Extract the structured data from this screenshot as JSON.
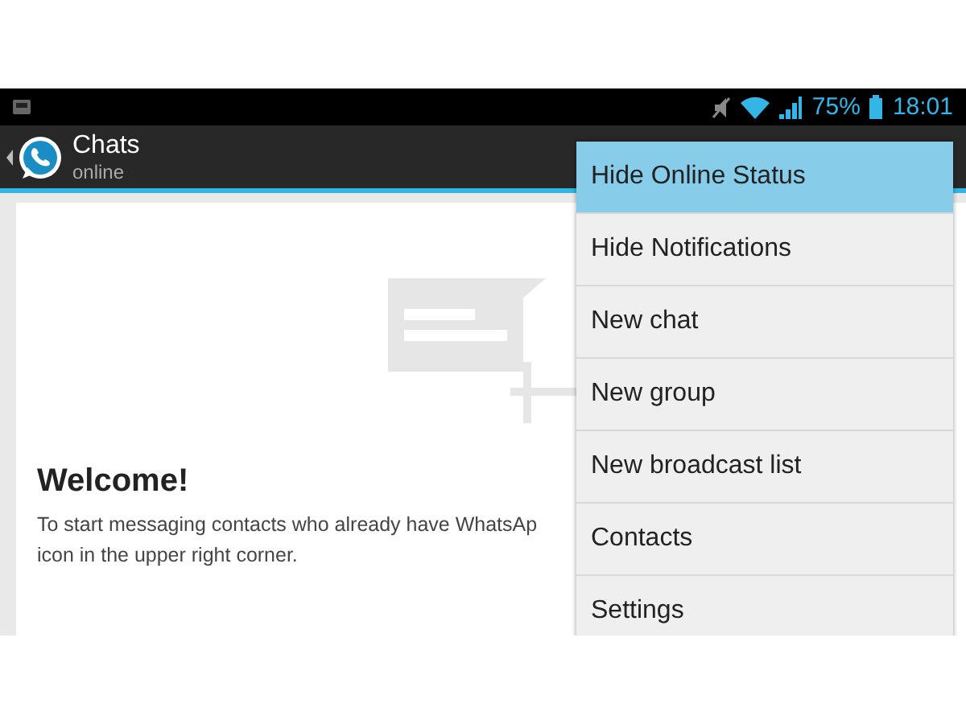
{
  "status_bar": {
    "battery": "75%",
    "time": "18:01"
  },
  "action_bar": {
    "title": "Chats",
    "subtitle": "online"
  },
  "welcome": {
    "heading": "Welcome!",
    "body_lines": [
      "To start messaging contacts who already have WhatsAp",
      "icon in the upper right corner."
    ]
  },
  "menu": [
    {
      "label": "Hide Online Status",
      "selected": true
    },
    {
      "label": "Hide Notifications",
      "selected": false
    },
    {
      "label": "New chat",
      "selected": false
    },
    {
      "label": "New group",
      "selected": false
    },
    {
      "label": "New broadcast list",
      "selected": false
    },
    {
      "label": "Contacts",
      "selected": false
    },
    {
      "label": "Settings",
      "selected": false
    }
  ]
}
